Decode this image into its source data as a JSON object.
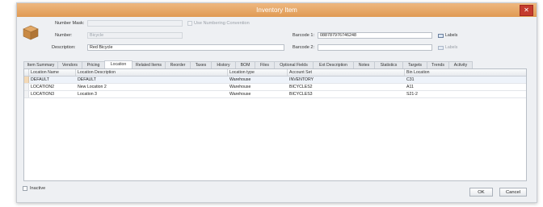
{
  "window": {
    "title": "Inventory Item",
    "close_glyph": "✕"
  },
  "header": {
    "number_mask_label": "Number Mask:",
    "number_mask_value": "",
    "use_numbering_label": "Use Numbering Convention",
    "number_label": "Number:",
    "number_value": "Bicycle",
    "description_label": "Description:",
    "description_value": "Red Bicycle",
    "barcode1_label": "Barcode 1:",
    "barcode1_value": "088787976746248",
    "barcode2_label": "Barcode 2:",
    "barcode2_value": "",
    "labels_btn1": "Labels",
    "labels_btn2": "Labels",
    "item_icon": "box-icon"
  },
  "tabs": [
    {
      "label": "Item Summary"
    },
    {
      "label": "Vendors"
    },
    {
      "label": "Pricing"
    },
    {
      "label": "Location"
    },
    {
      "label": "Related Items"
    },
    {
      "label": "Reorder"
    },
    {
      "label": "Taxes"
    },
    {
      "label": "History"
    },
    {
      "label": "BOM"
    },
    {
      "label": "Files"
    },
    {
      "label": "Optional Fields"
    },
    {
      "label": "Ext Description"
    },
    {
      "label": "Notes"
    },
    {
      "label": "Statistics"
    },
    {
      "label": "Targets"
    },
    {
      "label": "Trends"
    },
    {
      "label": "Activity"
    }
  ],
  "active_tab": "Location",
  "table": {
    "columns": [
      "Location Name",
      "Location Description",
      "Location type",
      "Account Set",
      "Bin Location"
    ],
    "rows": [
      [
        "DEFAULT",
        "DEFAULT",
        "Warehouse",
        "INVENTORY",
        "C31"
      ],
      [
        "LOCATION2",
        "New Location 2",
        "Warehouse",
        "BICYCLES2",
        "A11"
      ],
      [
        "LOCATION3",
        "Location 3",
        "Warehouse",
        "BICYCLES3",
        "S21-2"
      ]
    ]
  },
  "footer": {
    "inactive_label": "Inactive",
    "ok_label": "OK",
    "cancel_label": "Cancel"
  },
  "colors": {
    "titlebar": "#e6a461",
    "close": "#c43b2e",
    "selected_row": "#eef3fa"
  }
}
